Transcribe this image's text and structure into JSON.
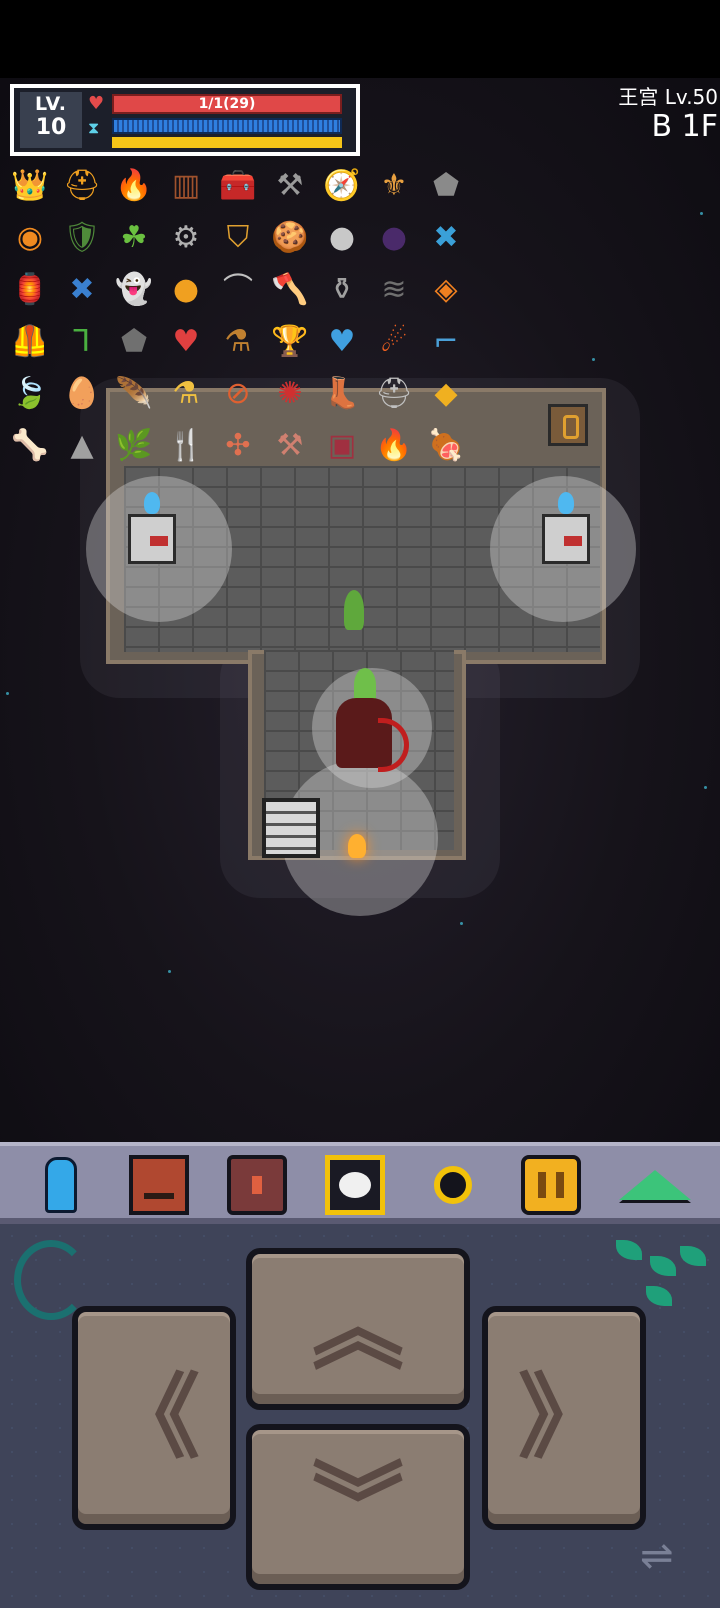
{
  "hud": {
    "level_label": "LV.",
    "level_value": "10",
    "hp_text": "1/1(29)",
    "xp_fraction": 1.0
  },
  "zone": {
    "name": "王宫 Lv.50",
    "floor": "B 1F"
  },
  "inventory": [
    {
      "icon": "golden-crown-icon",
      "glyph": "👑",
      "color": "#f2b820"
    },
    {
      "icon": "winged-helmet-icon",
      "glyph": "⛑",
      "color": "#f0a020"
    },
    {
      "icon": "fire-orb-icon",
      "glyph": "🔥",
      "color": "#e85a20"
    },
    {
      "icon": "wooden-fence-icon",
      "glyph": "▥",
      "color": "#a0522d"
    },
    {
      "icon": "blue-chest-icon",
      "glyph": "🧰",
      "color": "#3a8ad8"
    },
    {
      "icon": "anvil-icon",
      "glyph": "⚒",
      "color": "#9a9a9a"
    },
    {
      "icon": "purple-compass-icon",
      "glyph": "🧭",
      "color": "#8060d0"
    },
    {
      "icon": "royal-banner-icon",
      "glyph": "⚜",
      "color": "#e8a040"
    },
    {
      "icon": "stone-icon",
      "glyph": "⬟",
      "color": "#8a8a8a"
    },
    {
      "icon": "sun-ring-icon",
      "glyph": "◉",
      "color": "#f08a20"
    },
    {
      "icon": "leaf-shield-icon",
      "glyph": "🛡",
      "color": "#4f8a3a"
    },
    {
      "icon": "clover-icon",
      "glyph": "☘",
      "color": "#6ac040"
    },
    {
      "icon": "cog-icon",
      "glyph": "⚙",
      "color": "#b0b0b0"
    },
    {
      "icon": "red-badge-icon",
      "glyph": "⛉",
      "color": "#e0a030"
    },
    {
      "icon": "cookie-icon",
      "glyph": "🍪",
      "color": "#c07a40"
    },
    {
      "icon": "moon-orb-icon",
      "glyph": "●",
      "color": "#c8c8c8"
    },
    {
      "icon": "dark-orb-icon",
      "glyph": "●",
      "color": "#4a2a6a"
    },
    {
      "icon": "blue-cross-icon",
      "glyph": "✖",
      "color": "#3aa0d8"
    },
    {
      "icon": "lantern-icon",
      "glyph": "🏮",
      "color": "#b05030"
    },
    {
      "icon": "blue-x-icon",
      "glyph": "✖",
      "color": "#3a80d0"
    },
    {
      "icon": "ghost-icon",
      "glyph": "👻",
      "color": "#9ad0f0"
    },
    {
      "icon": "gold-coin-icon",
      "glyph": "●",
      "color": "#f0a020"
    },
    {
      "icon": "curved-blade-icon",
      "glyph": "⌒",
      "color": "#c0c0c0"
    },
    {
      "icon": "axe-icon",
      "glyph": "🪓",
      "color": "#a0a0a0"
    },
    {
      "icon": "cooking-pot-icon",
      "glyph": "⚱",
      "color": "#a0a0a0"
    },
    {
      "icon": "claw-icon",
      "glyph": "≋",
      "color": "#707070"
    },
    {
      "icon": "amber-gem-icon",
      "glyph": "◈",
      "color": "#f08020"
    },
    {
      "icon": "armor-icon",
      "glyph": "🦺",
      "color": "#c03030"
    },
    {
      "icon": "green-boomerang-icon",
      "glyph": "⅂",
      "color": "#4ab040"
    },
    {
      "icon": "rock-icon",
      "glyph": "⬟",
      "color": "#707070"
    },
    {
      "icon": "heart-wreath-icon",
      "glyph": "♥",
      "color": "#e04040"
    },
    {
      "icon": "potion-bottle-icon",
      "glyph": "⚗",
      "color": "#c08030"
    },
    {
      "icon": "blue-trophy-icon",
      "glyph": "🏆",
      "color": "#3a90d8"
    },
    {
      "icon": "blue-heart-icon",
      "glyph": "♥",
      "color": "#40a0e0"
    },
    {
      "icon": "comet-icon",
      "glyph": "☄",
      "color": "#f06020"
    },
    {
      "icon": "blue-pipe-icon",
      "glyph": "⌐",
      "color": "#4aa0d8"
    },
    {
      "icon": "green-leaf-icon",
      "glyph": "🍃",
      "color": "#4ab040"
    },
    {
      "icon": "blue-egg-icon",
      "glyph": "🥚",
      "color": "#4aa0e8"
    },
    {
      "icon": "purple-feather-icon",
      "glyph": "🪶",
      "color": "#b060e0"
    },
    {
      "icon": "yellow-flask-icon",
      "glyph": "⚗",
      "color": "#f0c040"
    },
    {
      "icon": "compass-needle-icon",
      "glyph": "⊘",
      "color": "#e06030"
    },
    {
      "icon": "red-seal-icon",
      "glyph": "✺",
      "color": "#d03030"
    },
    {
      "icon": "green-boot-icon",
      "glyph": "👢",
      "color": "#4ab040"
    },
    {
      "icon": "helmet-icon",
      "glyph": "⛑",
      "color": "#c0c0c0"
    },
    {
      "icon": "gold-diamond-icon",
      "glyph": "◆",
      "color": "#f0b020"
    },
    {
      "icon": "bone-icon",
      "glyph": "🦴",
      "color": "#c0c0c0"
    },
    {
      "icon": "stone-tooth-icon",
      "glyph": "▲",
      "color": "#a0a0a0"
    },
    {
      "icon": "green-torch-icon",
      "glyph": "🌿",
      "color": "#4ab040"
    },
    {
      "icon": "fork-icon",
      "glyph": "🍴",
      "color": "#c0c0c0"
    },
    {
      "icon": "arrow-tile-icon",
      "glyph": "✣",
      "color": "#e07050"
    },
    {
      "icon": "anvil-hammer-icon",
      "glyph": "⚒",
      "color": "#d08070"
    },
    {
      "icon": "dark-box-icon",
      "glyph": "▣",
      "color": "#a03040"
    },
    {
      "icon": "flame-icon",
      "glyph": "🔥",
      "color": "#e84020"
    },
    {
      "icon": "meat-icon",
      "glyph": "🍖",
      "color": "#e0a080"
    }
  ],
  "toolbar": [
    {
      "icon": "character-icon"
    },
    {
      "icon": "book-icon"
    },
    {
      "icon": "bag-icon"
    },
    {
      "icon": "target-icon"
    },
    {
      "icon": "search-icon"
    },
    {
      "icon": "pause-icon"
    },
    {
      "icon": "ascend-icon"
    }
  ],
  "dpad": {
    "up": "︽",
    "left": "《",
    "right": "》",
    "down": "︾",
    "swap": "⇌"
  }
}
